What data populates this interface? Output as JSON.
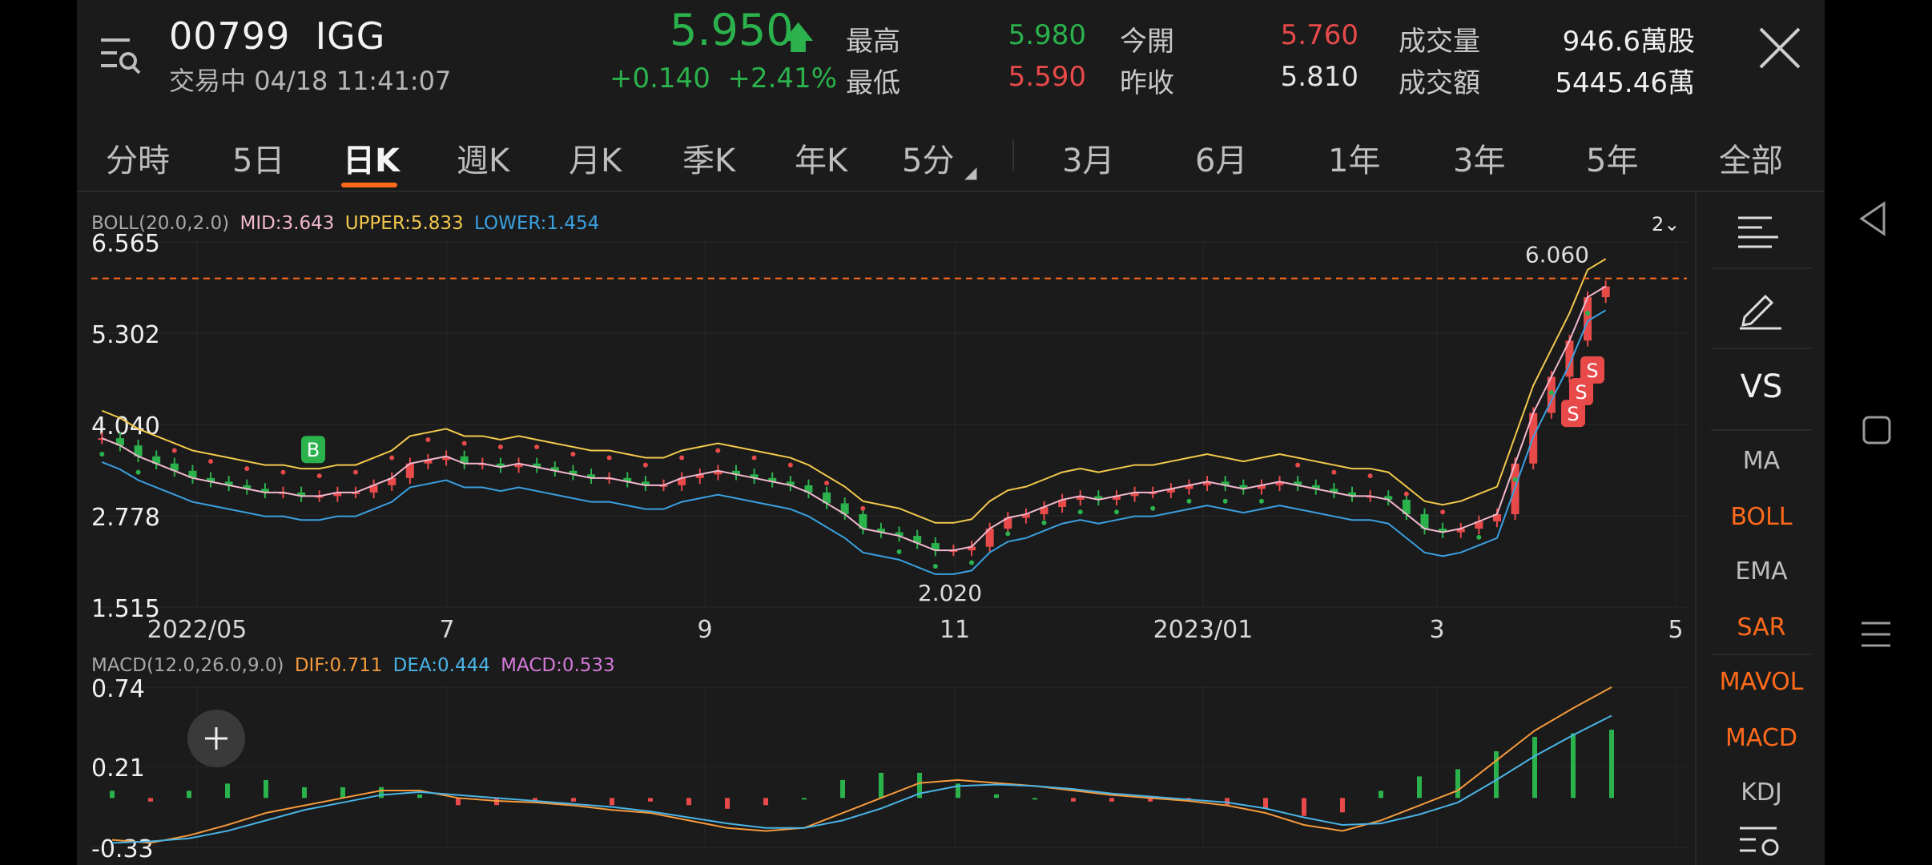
{
  "header": {
    "code": "00799",
    "name": "IGG",
    "status": "交易中",
    "datetime": "04/18 11:41:07",
    "price": "5.950",
    "change": "+0.140",
    "change_pct": "+2.41%",
    "stats": [
      {
        "label": "最高",
        "value": "5.980",
        "color": "#2bb24c"
      },
      {
        "label": "最低",
        "value": "5.590",
        "color": "#e84a4a"
      },
      {
        "label": "今開",
        "value": "5.760",
        "color": "#e84a4a"
      },
      {
        "label": "昨收",
        "value": "5.810",
        "color": "#e6e6e6"
      },
      {
        "label": "成交量",
        "value": "946.6萬股",
        "color": "#f0f0f0"
      },
      {
        "label": "成交額",
        "value": "5445.46萬",
        "color": "#f0f0f0"
      }
    ]
  },
  "tabs": [
    "分時",
    "5日",
    "日K",
    "週K",
    "月K",
    "季K",
    "年K",
    "5分",
    "3月",
    "6月",
    "1年",
    "3年",
    "5年",
    "全部"
  ],
  "active_tab": "日K",
  "sidebar": {
    "vs_label": "VS",
    "indicators": [
      {
        "label": "MA",
        "active": false
      },
      {
        "label": "BOLL",
        "active": true
      },
      {
        "label": "EMA",
        "active": false
      },
      {
        "label": "SAR",
        "active": true
      },
      {
        "label": "MAVOL",
        "active": true
      },
      {
        "label": "MACD",
        "active": true
      },
      {
        "label": "KDJ",
        "active": false
      }
    ]
  },
  "boll_legend": {
    "name": "BOLL(20.0,2.0)",
    "mid": "MID:3.643",
    "upper": "UPPER:5.833",
    "lower": "LOWER:1.454",
    "zoom": "2"
  },
  "macd_legend": {
    "name": "MACD(12.0,26.0,9.0)",
    "dif": "DIF:0.711",
    "dea": "DEA:0.444",
    "macd": "MACD:0.533"
  },
  "colors": {
    "up": "#e84a4a",
    "down": "#2bb24c",
    "accent": "#ff6a1a",
    "mid": "#f2b8d0",
    "upper": "#f2c94c",
    "lower": "#3aa0e0",
    "dif": "#f59a3c",
    "dea": "#4ab4e6"
  },
  "chart_data": [
    {
      "type": "candlestick",
      "title": "",
      "y_ticks": [
        "6.565",
        "5.302",
        "4.040",
        "2.778",
        "1.515"
      ],
      "ylim": [
        1.515,
        6.565
      ],
      "x_ticks": [
        "2022/05",
        "7",
        "9",
        "11",
        "2023/01",
        "3",
        "5"
      ],
      "annotations": {
        "high": "6.060",
        "low": "2.020",
        "buy_marker": "B",
        "sell_marker": "S"
      },
      "close_series": [
        3.85,
        3.75,
        3.6,
        3.5,
        3.4,
        3.3,
        3.25,
        3.2,
        3.15,
        3.1,
        3.1,
        3.05,
        3.05,
        3.1,
        3.1,
        3.2,
        3.3,
        3.5,
        3.55,
        3.6,
        3.5,
        3.5,
        3.45,
        3.5,
        3.45,
        3.4,
        3.35,
        3.3,
        3.3,
        3.25,
        3.2,
        3.2,
        3.3,
        3.35,
        3.4,
        3.35,
        3.3,
        3.25,
        3.2,
        3.1,
        2.95,
        2.8,
        2.6,
        2.55,
        2.5,
        2.4,
        2.3,
        2.3,
        2.35,
        2.6,
        2.75,
        2.8,
        2.9,
        3.0,
        3.05,
        3.0,
        3.05,
        3.1,
        3.1,
        3.15,
        3.2,
        3.25,
        3.2,
        3.15,
        3.2,
        3.25,
        3.2,
        3.15,
        3.1,
        3.05,
        3.05,
        3.0,
        2.8,
        2.6,
        2.55,
        2.6,
        2.7,
        2.8,
        3.5,
        4.2,
        4.7,
        5.2,
        5.8,
        5.95
      ]
    },
    {
      "type": "bar+line",
      "title": "",
      "y_ticks": [
        "0.74",
        "0.21",
        "-0.33"
      ],
      "ylim": [
        -0.33,
        0.74
      ],
      "series": [
        {
          "name": "DIF",
          "values": [
            -0.28,
            -0.3,
            -0.25,
            -0.18,
            -0.1,
            -0.05,
            0.0,
            0.05,
            0.05,
            0.0,
            -0.02,
            -0.03,
            -0.05,
            -0.08,
            -0.1,
            -0.15,
            -0.2,
            -0.22,
            -0.2,
            -0.1,
            0.0,
            0.1,
            0.12,
            0.1,
            0.08,
            0.05,
            0.02,
            0.0,
            -0.02,
            -0.05,
            -0.1,
            -0.18,
            -0.22,
            -0.15,
            -0.05,
            0.05,
            0.25,
            0.45,
            0.6,
            0.74
          ]
        },
        {
          "name": "DEA",
          "values": [
            -0.3,
            -0.29,
            -0.27,
            -0.22,
            -0.15,
            -0.08,
            -0.03,
            0.02,
            0.04,
            0.02,
            0.0,
            -0.02,
            -0.04,
            -0.06,
            -0.09,
            -0.13,
            -0.17,
            -0.2,
            -0.2,
            -0.15,
            -0.07,
            0.03,
            0.08,
            0.09,
            0.08,
            0.06,
            0.03,
            0.01,
            -0.01,
            -0.03,
            -0.07,
            -0.13,
            -0.18,
            -0.17,
            -0.11,
            -0.03,
            0.12,
            0.28,
            0.42,
            0.55
          ]
        }
      ]
    }
  ]
}
